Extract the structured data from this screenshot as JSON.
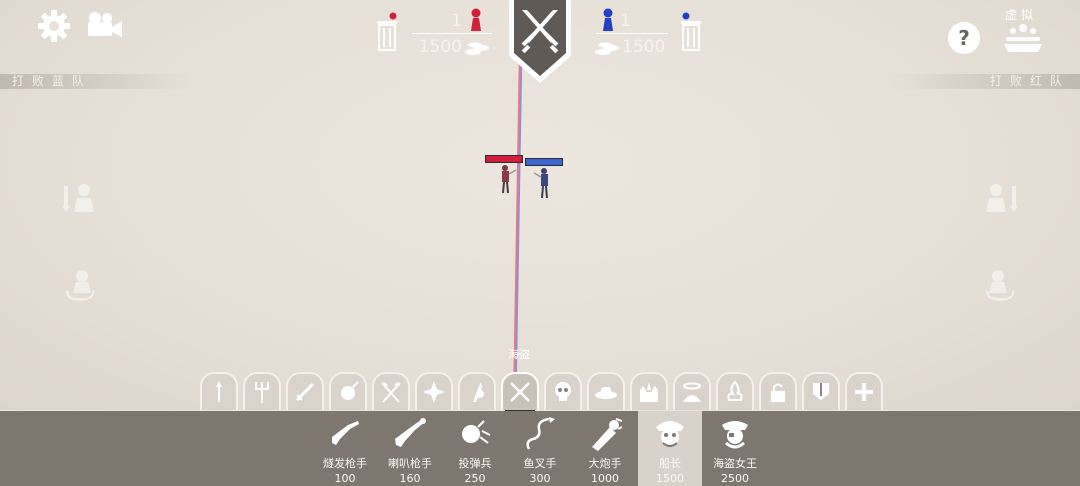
{
  "top_left": {
    "settings_icon": "gear-icon",
    "camera_icon": "video-camera-icon"
  },
  "red_team": {
    "unit_count": "1",
    "budget": "1500",
    "banner": "打败蓝队",
    "color": "#d0203a"
  },
  "blue_team": {
    "unit_count": "1",
    "budget": "1500",
    "banner": "打败红队",
    "color": "#2040c8"
  },
  "top_right": {
    "help_label": "?",
    "simulate_label": "虚拟"
  },
  "faction": {
    "label": "海盗"
  },
  "categories": [
    {
      "name": "tribal",
      "icon": "spear-icon"
    },
    {
      "name": "farmer",
      "icon": "pitchfork-icon"
    },
    {
      "name": "medieval",
      "icon": "sword-icon"
    },
    {
      "name": "ancient",
      "icon": "shield-spear-icon"
    },
    {
      "name": "viking",
      "icon": "crossed-axes-icon"
    },
    {
      "name": "dynasty",
      "icon": "shuriken-icon"
    },
    {
      "name": "renaissance",
      "icon": "lance-icon"
    },
    {
      "name": "pirate",
      "icon": "crossed-swords-icon",
      "active": true
    },
    {
      "name": "spooky",
      "icon": "skull-icon"
    },
    {
      "name": "wild-west",
      "icon": "cowboy-hat-icon"
    },
    {
      "name": "legacy",
      "icon": "castle-icon"
    },
    {
      "name": "good",
      "icon": "halo-icon"
    },
    {
      "name": "evil",
      "icon": "flame-icon"
    },
    {
      "name": "secret",
      "icon": "padlock-icon"
    },
    {
      "name": "custom",
      "icon": "banner-icon"
    },
    {
      "name": "add",
      "icon": "plus-icon"
    }
  ],
  "units": [
    {
      "name": "燧发枪手",
      "cost": "100",
      "icon": "flintlock-icon"
    },
    {
      "name": "喇叭枪手",
      "cost": "160",
      "icon": "blunderbuss-icon"
    },
    {
      "name": "投弹兵",
      "cost": "250",
      "icon": "bomb-icon"
    },
    {
      "name": "鱼叉手",
      "cost": "300",
      "icon": "harpoon-icon"
    },
    {
      "name": "大炮手",
      "cost": "1000",
      "icon": "cannon-icon"
    },
    {
      "name": "船长",
      "cost": "1500",
      "icon": "captain-icon",
      "selected": true
    },
    {
      "name": "海盗女王",
      "cost": "2500",
      "icon": "pirate-queen-icon"
    }
  ]
}
